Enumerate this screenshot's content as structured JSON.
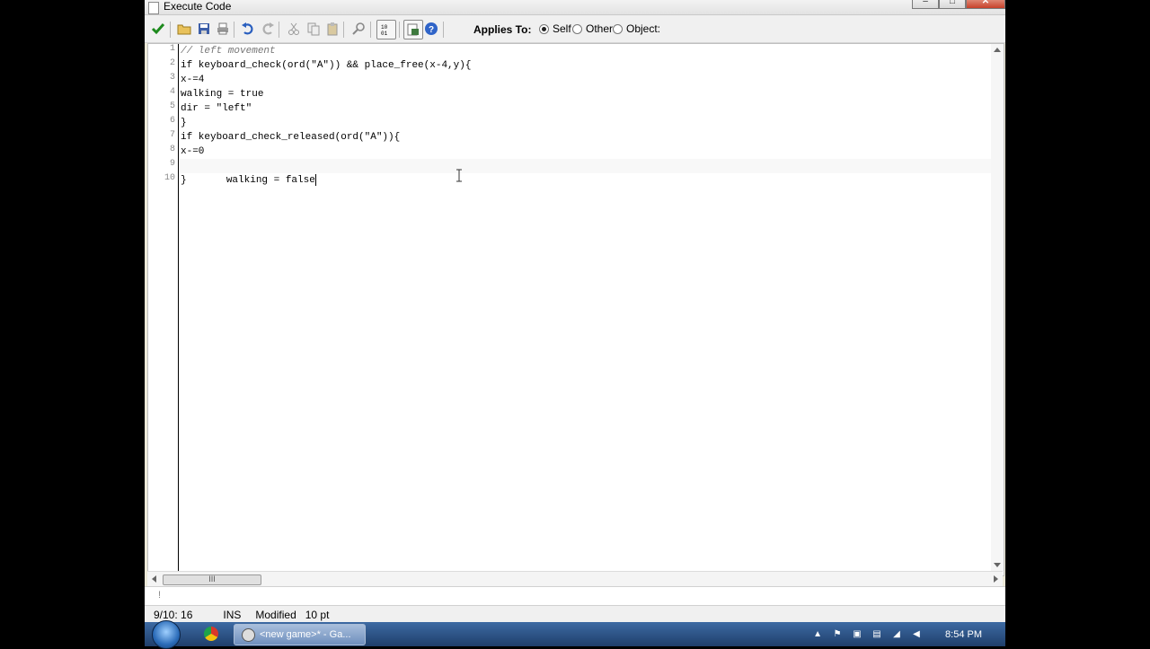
{
  "window": {
    "title": "Execute Code",
    "controls": [
      "–",
      "□",
      "✕"
    ]
  },
  "toolbar": {
    "applies_to_label": "Applies To:",
    "options": [
      {
        "label": "Self",
        "checked": true
      },
      {
        "label": "Other",
        "checked": false
      },
      {
        "label": "Object:",
        "checked": false
      }
    ]
  },
  "editor": {
    "line_numbers": [
      "1",
      "2",
      "3",
      "4",
      "5",
      "6",
      "7",
      "8",
      "9",
      "10"
    ],
    "lines": [
      {
        "text": "// left movement",
        "kind": "comment"
      },
      {
        "text": "if keyboard_check(ord(\"A\")) && place_free(x-4,y){",
        "kind": "code"
      },
      {
        "text": "x-=4",
        "kind": "code"
      },
      {
        "text": "walking = true",
        "kind": "code"
      },
      {
        "text": "dir = \"left\"",
        "kind": "code"
      },
      {
        "text": "}",
        "kind": "code"
      },
      {
        "text": "if keyboard_check_released(ord(\"A\")){",
        "kind": "code"
      },
      {
        "text": "x-=0",
        "kind": "code"
      },
      {
        "text": "walking = false",
        "kind": "code"
      },
      {
        "text": "}",
        "kind": "code"
      }
    ],
    "scrollbar_grip": "III",
    "info_text": "!"
  },
  "status": {
    "position": "9/10: 16",
    "mode": "INS",
    "state": "Modified",
    "font_size": "10 pt"
  },
  "taskbar": {
    "task_label": "<new game>* - Ga...",
    "clock": "8:54 PM"
  },
  "colors": {
    "accent": "#3d6aa3",
    "comment": "#777777"
  }
}
